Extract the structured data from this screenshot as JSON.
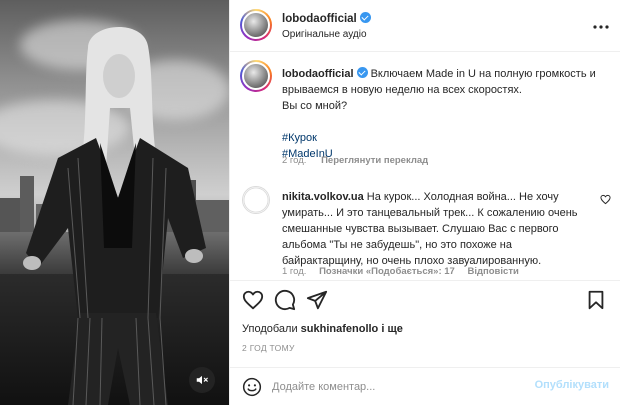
{
  "header": {
    "username": "lobodaofficial",
    "audio_label": "Оригінальне аудіо",
    "more_icon": "more-horizontal-icon"
  },
  "caption": {
    "username": "lobodaofficial",
    "text_line1": "Включаем Made in U на полную громкость и",
    "text_line2": "врываемся в новую неделю на всех скоростях.",
    "text_line3": "Вы со мной?",
    "hashtag1": "#Курок",
    "hashtag2": "#MadeInU",
    "time": "2 год.",
    "translate_label": "Переглянути переклад"
  },
  "comment": {
    "username": "nikita.volkov.ua",
    "line1": "На курок... Холодная война... Не хочу",
    "line2": "умирать... И это танцевальный трек... К сожалению очень",
    "line3": "смешанные чувства вызывает. Слушаю Вас с первого",
    "line4": "альбома \"Ты не забудешь\", но это похоже на",
    "line5": "байрактарщину, но очень плохо завуалированную.",
    "time": "1 год.",
    "likes": "Позначки «Подобається»: 17",
    "reply_label": "Відповісти"
  },
  "actions": {
    "like_icon": "heart-icon",
    "comment_icon": "comment-icon",
    "share_icon": "send-icon",
    "save_icon": "bookmark-icon"
  },
  "likes": {
    "prefix": "Уподобали",
    "user": "sukhinafenollo",
    "suffix": "і ще"
  },
  "date": "2 ГОД ТОМУ",
  "add_comment": {
    "placeholder": "Додайте коментар...",
    "post_label": "Опублікувати",
    "emoji_icon": "smiley-icon"
  },
  "media": {
    "mute_icon": "speaker-muted-icon"
  },
  "colors": {
    "verified": "#3897f0",
    "hashtag": "#00376b",
    "muted_text": "#8e8e8e",
    "post_disabled": "#b2dffc"
  }
}
